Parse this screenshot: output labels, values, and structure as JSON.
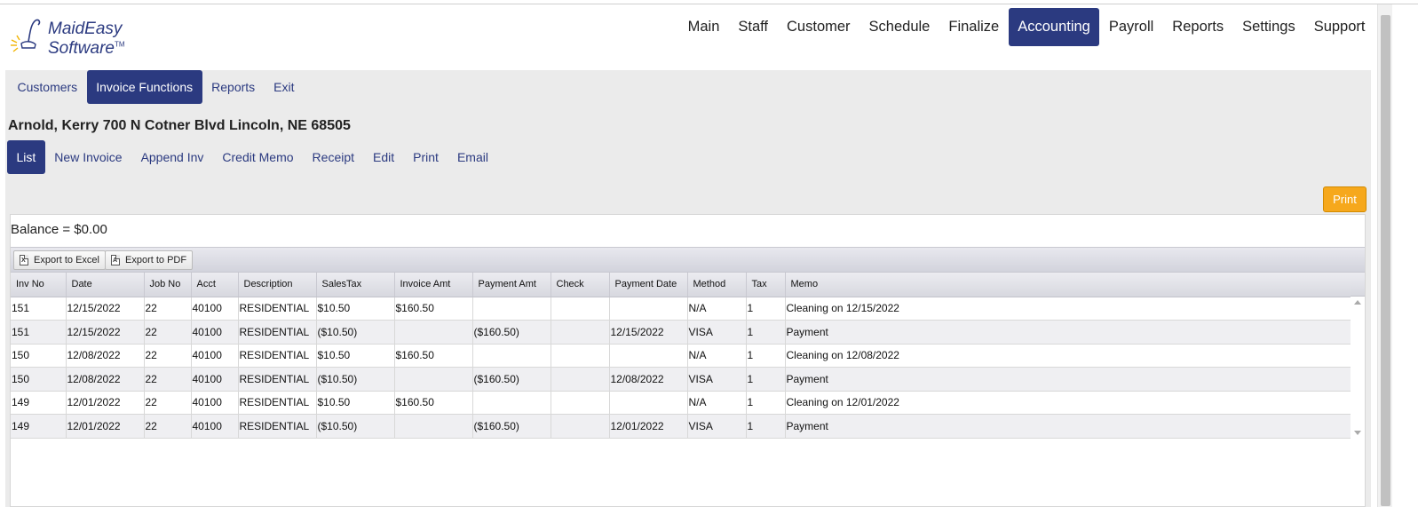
{
  "app": {
    "logo_line1": "MaidEasy",
    "logo_line2": "Software",
    "logo_tm": "TM"
  },
  "main_nav": [
    {
      "label": "Main",
      "active": false
    },
    {
      "label": "Staff",
      "active": false
    },
    {
      "label": "Customer",
      "active": false
    },
    {
      "label": "Schedule",
      "active": false
    },
    {
      "label": "Finalize",
      "active": false
    },
    {
      "label": "Accounting",
      "active": true
    },
    {
      "label": "Payroll",
      "active": false
    },
    {
      "label": "Reports",
      "active": false
    },
    {
      "label": "Settings",
      "active": false
    },
    {
      "label": "Support",
      "active": false
    }
  ],
  "sub_nav": [
    {
      "label": "Customers",
      "active": false
    },
    {
      "label": "Invoice Functions",
      "active": true
    },
    {
      "label": "Reports",
      "active": false
    },
    {
      "label": "Exit",
      "active": false
    }
  ],
  "customer_title": "Arnold, Kerry 700 N Cotner Blvd Lincoln, NE 68505",
  "action_nav": [
    {
      "label": "List",
      "active": true
    },
    {
      "label": "New Invoice",
      "active": false
    },
    {
      "label": "Append Inv",
      "active": false
    },
    {
      "label": "Credit Memo",
      "active": false
    },
    {
      "label": "Receipt",
      "active": false
    },
    {
      "label": "Edit",
      "active": false
    },
    {
      "label": "Print",
      "active": false
    },
    {
      "label": "Email",
      "active": false
    }
  ],
  "print_button": "Print",
  "balance": "Balance = $0.00",
  "toolbar": {
    "export_excel": "Export to Excel",
    "export_pdf": "Export to PDF"
  },
  "colors": {
    "nav_active": "#2b3a80",
    "print_button": "#f6a81c",
    "panel": "#ebebeb"
  },
  "table": {
    "columns": [
      "Inv No",
      "Date",
      "Job No",
      "Acct",
      "Description",
      "SalesTax",
      "Invoice Amt",
      "Payment Amt",
      "Check",
      "Payment Date",
      "Method",
      "Tax",
      "Memo"
    ],
    "rows": [
      [
        "151",
        "12/15/2022",
        "22",
        "40100",
        "RESIDENTIAL",
        "$10.50",
        "$160.50",
        "",
        "",
        "",
        "N/A",
        "1",
        "Cleaning on 12/15/2022"
      ],
      [
        "151",
        "12/15/2022",
        "22",
        "40100",
        "RESIDENTIAL",
        "($10.50)",
        "",
        "($160.50)",
        "",
        "12/15/2022",
        "VISA",
        "1",
        "Payment"
      ],
      [
        "150",
        "12/08/2022",
        "22",
        "40100",
        "RESIDENTIAL",
        "$10.50",
        "$160.50",
        "",
        "",
        "",
        "N/A",
        "1",
        "Cleaning on 12/08/2022"
      ],
      [
        "150",
        "12/08/2022",
        "22",
        "40100",
        "RESIDENTIAL",
        "($10.50)",
        "",
        "($160.50)",
        "",
        "12/08/2022",
        "VISA",
        "1",
        "Payment"
      ],
      [
        "149",
        "12/01/2022",
        "22",
        "40100",
        "RESIDENTIAL",
        "$10.50",
        "$160.50",
        "",
        "",
        "",
        "N/A",
        "1",
        "Cleaning on 12/01/2022"
      ],
      [
        "149",
        "12/01/2022",
        "22",
        "40100",
        "RESIDENTIAL",
        "($10.50)",
        "",
        "($160.50)",
        "",
        "12/01/2022",
        "VISA",
        "1",
        "Payment"
      ]
    ]
  }
}
